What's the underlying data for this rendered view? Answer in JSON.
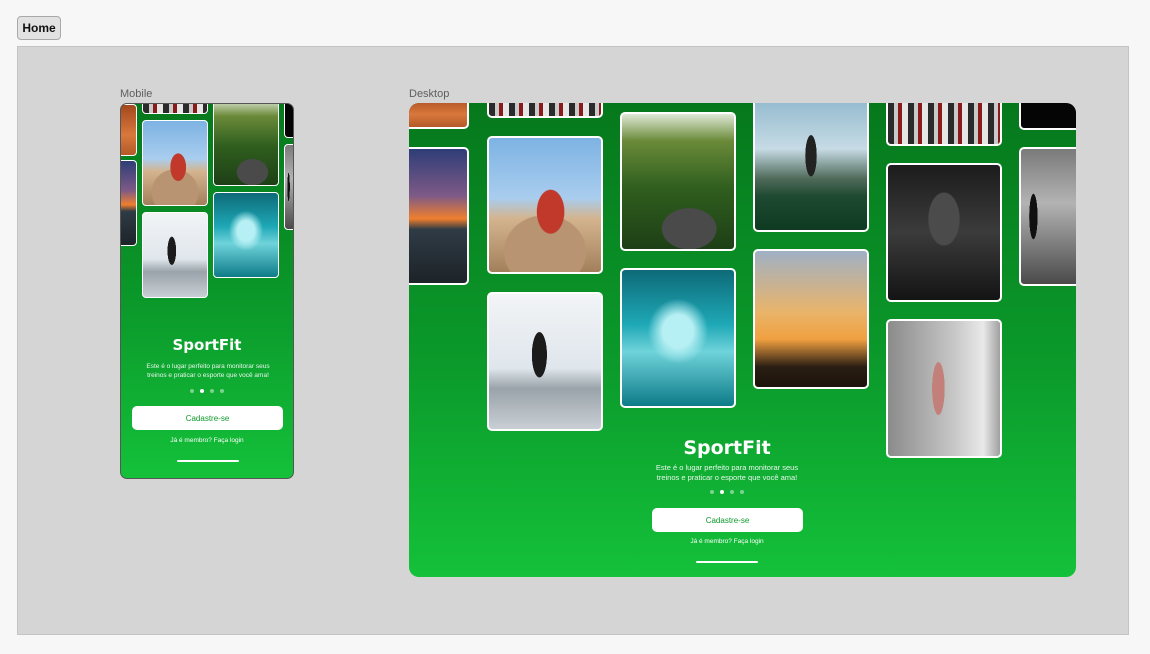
{
  "toolbar": {
    "home_label": "Home"
  },
  "frames": {
    "mobile": {
      "label": "Mobile"
    },
    "desktop": {
      "label": "Desktop"
    }
  },
  "app": {
    "name": "SportFit",
    "tagline": "Este é o lugar perfeito para monitorar seus treinos e praticar o esporte que você ama!",
    "tagline_line1": "Este é o lugar perfeito para monitorar seus",
    "tagline_line2": "treinos e praticar o esporte que você ama!",
    "cta_label": "Cadastre-se",
    "login_label": "Já é membro? Faça login",
    "carousel": {
      "total": 4,
      "active": 2
    }
  },
  "colors": {
    "brand_green": "#0d9a2b",
    "gradient_top": "#06781c",
    "gradient_bottom": "#14c13a"
  }
}
